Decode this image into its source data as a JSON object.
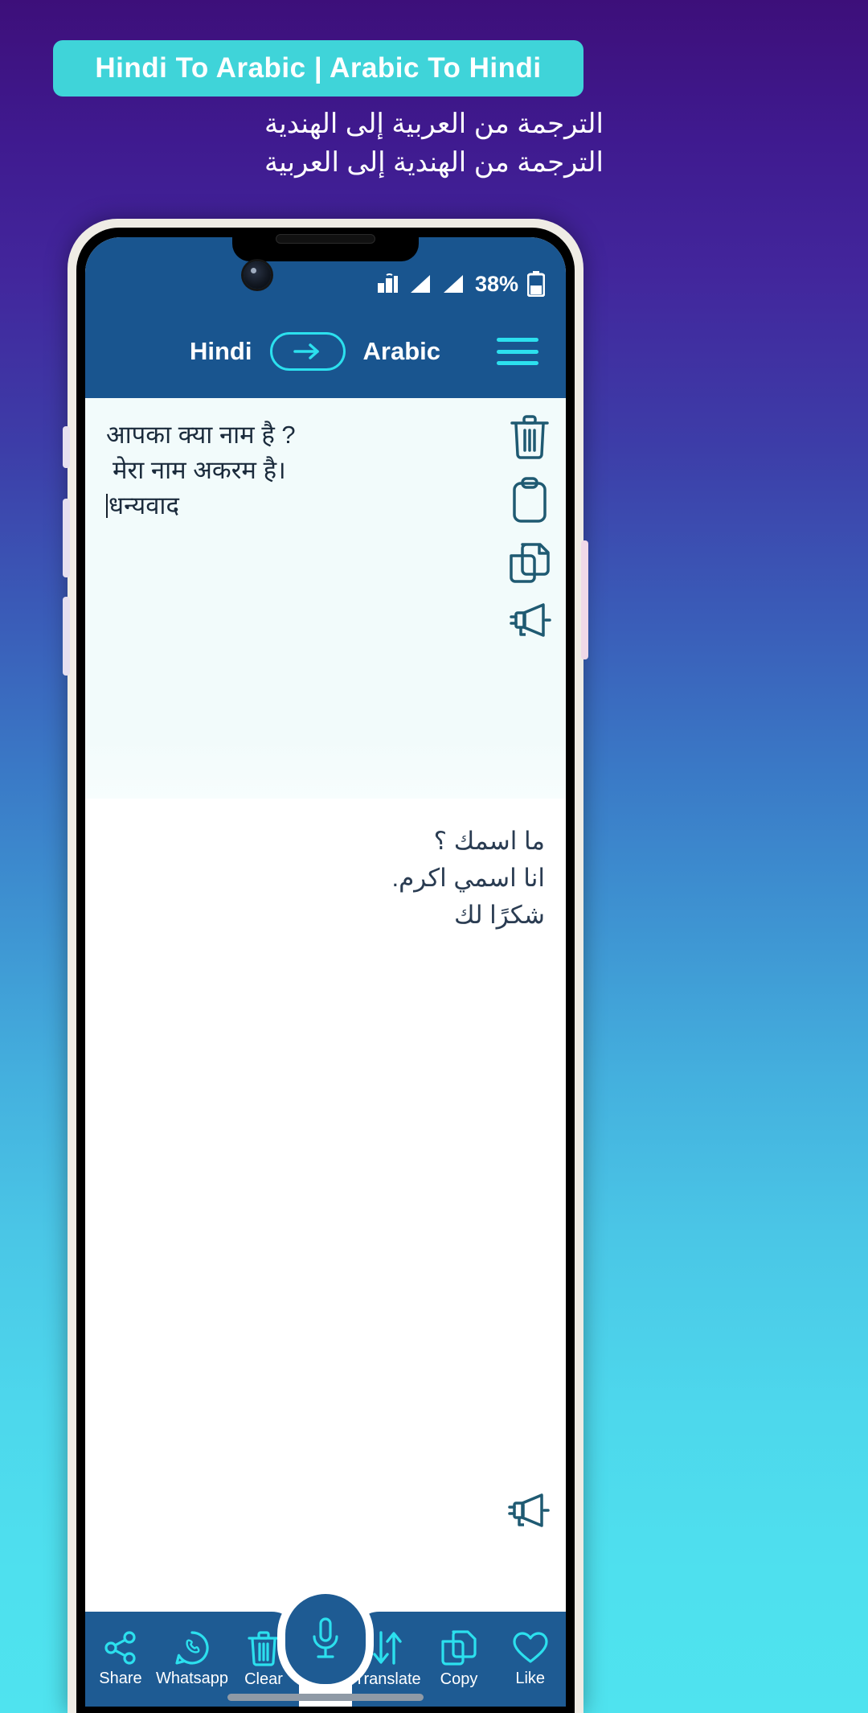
{
  "promo": {
    "banner_title": "Hindi To Arabic | Arabic To Hindi",
    "subtitle_line1": "الترجمة من العربية إلى الهندية",
    "subtitle_line2": "الترجمة من الهندية إلى العربية",
    "banner_color": "#3fd4d9",
    "background_top_color": "#3d0f7a",
    "background_bottom_color": "#4fe3ef"
  },
  "statusbar": {
    "battery_percent": "38%",
    "icons": [
      "wifi-signal-icon",
      "signal-bars-icon",
      "signal-bars-icon",
      "battery-icon"
    ]
  },
  "appbar": {
    "source_language": "Hindi",
    "target_language": "Arabic",
    "swap_icon": "arrow-right-icon",
    "menu_icon": "hamburger-menu-icon",
    "bar_color": "#19558f",
    "accent_color": "#2ce0ee"
  },
  "input_panel": {
    "lines": [
      "आपका क्या नाम है ?",
      "मेरा नाम अकरम है।",
      "धन्यवाद"
    ],
    "text_color": "#1b2b3c",
    "background_color": "#f2fbfb",
    "actions": [
      {
        "name": "delete-icon",
        "label": "Delete"
      },
      {
        "name": "paste-icon",
        "label": "Paste"
      },
      {
        "name": "copy-icon",
        "label": "Copy"
      },
      {
        "name": "speaker-icon",
        "label": "Speak"
      }
    ]
  },
  "output_panel": {
    "lines": [
      "ما اسمك ؟",
      "انا اسمي اكرم.",
      "شكرًا لك"
    ],
    "text_color": "#2a3c52",
    "background_color": "#ffffff",
    "speaker_icon": "speaker-icon"
  },
  "bottombar": {
    "bar_color": "#1e5b93",
    "icon_color": "#2ce0ee",
    "left_items": [
      {
        "label": "Share",
        "icon": "share-icon"
      },
      {
        "label": "Whatsapp",
        "icon": "whatsapp-icon"
      },
      {
        "label": "Clear",
        "icon": "trash-icon"
      }
    ],
    "mic": {
      "label": "",
      "icon": "microphone-icon"
    },
    "right_items": [
      {
        "label": "Translate",
        "icon": "translate-arrows-icon"
      },
      {
        "label": "Copy",
        "icon": "copy-icon"
      },
      {
        "label": "Like",
        "icon": "heart-icon"
      }
    ]
  }
}
